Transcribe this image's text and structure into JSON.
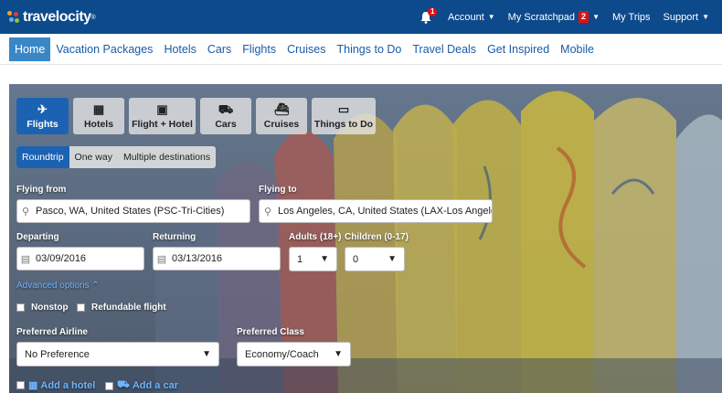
{
  "header": {
    "logo_text": "travelocity",
    "notification_count": "1",
    "account_label": "Account",
    "scratchpad_label": "My Scratchpad",
    "scratchpad_count": "2",
    "trips_label": "My Trips",
    "support_label": "Support",
    "colors": {
      "bar": "#0c4a8c",
      "badge": "#dd1111"
    }
  },
  "nav": {
    "tabs": [
      {
        "label": "Home",
        "active": true
      },
      {
        "label": "Vacation Packages"
      },
      {
        "label": "Hotels"
      },
      {
        "label": "Cars"
      },
      {
        "label": "Flights"
      },
      {
        "label": "Cruises"
      },
      {
        "label": "Things to Do"
      },
      {
        "label": "Travel Deals"
      },
      {
        "label": "Get Inspired"
      },
      {
        "label": "Mobile"
      }
    ]
  },
  "search": {
    "product_tabs": [
      {
        "label": "Flights",
        "icon": "plane-icon",
        "active": true
      },
      {
        "label": "Hotels",
        "icon": "building-icon"
      },
      {
        "label": "Flight + Hotel",
        "icon": "luggage-icon"
      },
      {
        "label": "Cars",
        "icon": "car-icon"
      },
      {
        "label": "Cruises",
        "icon": "ship-icon"
      },
      {
        "label": "Things to Do",
        "icon": "ticket-icon"
      }
    ],
    "trip_types": [
      {
        "label": "Roundtrip",
        "active": true
      },
      {
        "label": "One way"
      },
      {
        "label": "Multiple destinations"
      }
    ],
    "flying_from_label": "Flying from",
    "flying_from_value": "Pasco, WA, United States (PSC-Tri-Cities)",
    "flying_to_label": "Flying to",
    "flying_to_value": "Los Angeles, CA, United States (LAX-Los Angeles)",
    "departing_label": "Departing",
    "departing_value": "03/09/2016",
    "returning_label": "Returning",
    "returning_value": "03/13/2016",
    "adults_label": "Adults (18+)",
    "adults_value": "1",
    "children_label": "Children (0-17)",
    "children_value": "0",
    "advanced_label": "Advanced options",
    "nonstop_label": "Nonstop",
    "refundable_label": "Refundable flight",
    "airline_label": "Preferred Airline",
    "airline_value": "No Preference",
    "class_label": "Preferred Class",
    "class_value": "Economy/Coach",
    "add_hotel_label": "Add a hotel",
    "add_car_label": "Add a car",
    "colors": {
      "active_tab": "#1c62b2",
      "link": "#6cb4ff"
    }
  }
}
